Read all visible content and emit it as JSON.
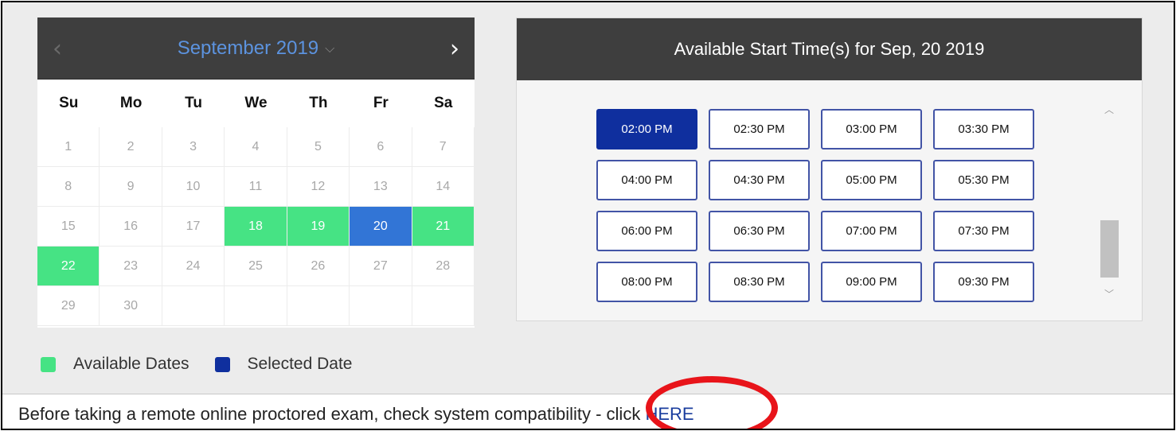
{
  "calendar": {
    "month_label": "September 2019",
    "prev_icon": "‹",
    "next_icon": "›",
    "caret_icon": "⌵",
    "weekdays": [
      "Su",
      "Mo",
      "Tu",
      "We",
      "Th",
      "Fr",
      "Sa"
    ],
    "days": [
      {
        "label": "1",
        "state": "disabled"
      },
      {
        "label": "2",
        "state": "disabled"
      },
      {
        "label": "3",
        "state": "disabled"
      },
      {
        "label": "4",
        "state": "disabled"
      },
      {
        "label": "5",
        "state": "disabled"
      },
      {
        "label": "6",
        "state": "disabled"
      },
      {
        "label": "7",
        "state": "disabled"
      },
      {
        "label": "8",
        "state": "disabled"
      },
      {
        "label": "9",
        "state": "disabled"
      },
      {
        "label": "10",
        "state": "disabled"
      },
      {
        "label": "11",
        "state": "disabled"
      },
      {
        "label": "12",
        "state": "disabled"
      },
      {
        "label": "13",
        "state": "disabled"
      },
      {
        "label": "14",
        "state": "disabled"
      },
      {
        "label": "15",
        "state": "disabled"
      },
      {
        "label": "16",
        "state": "disabled"
      },
      {
        "label": "17",
        "state": "disabled"
      },
      {
        "label": "18",
        "state": "available"
      },
      {
        "label": "19",
        "state": "available"
      },
      {
        "label": "20",
        "state": "selected"
      },
      {
        "label": "21",
        "state": "available"
      },
      {
        "label": "22",
        "state": "available"
      },
      {
        "label": "23",
        "state": "disabled"
      },
      {
        "label": "24",
        "state": "disabled"
      },
      {
        "label": "25",
        "state": "disabled"
      },
      {
        "label": "26",
        "state": "disabled"
      },
      {
        "label": "27",
        "state": "disabled"
      },
      {
        "label": "28",
        "state": "disabled"
      },
      {
        "label": "29",
        "state": "disabled"
      },
      {
        "label": "30",
        "state": "disabled"
      },
      {
        "label": "",
        "state": "blank"
      },
      {
        "label": "",
        "state": "blank"
      },
      {
        "label": "",
        "state": "blank"
      },
      {
        "label": "",
        "state": "blank"
      },
      {
        "label": "",
        "state": "blank"
      }
    ]
  },
  "legend": {
    "available_label": "Available Dates",
    "selected_label": "Selected Date",
    "available_color": "#46e384",
    "selected_color": "#0f2f9e"
  },
  "times": {
    "title": "Available Start Time(s) for Sep, 20 2019",
    "slots": [
      {
        "label": "02:00 PM",
        "selected": true
      },
      {
        "label": "02:30 PM",
        "selected": false
      },
      {
        "label": "03:00 PM",
        "selected": false
      },
      {
        "label": "03:30 PM",
        "selected": false
      },
      {
        "label": "04:00 PM",
        "selected": false
      },
      {
        "label": "04:30 PM",
        "selected": false
      },
      {
        "label": "05:00 PM",
        "selected": false
      },
      {
        "label": "05:30 PM",
        "selected": false
      },
      {
        "label": "06:00 PM",
        "selected": false
      },
      {
        "label": "06:30 PM",
        "selected": false
      },
      {
        "label": "07:00 PM",
        "selected": false
      },
      {
        "label": "07:30 PM",
        "selected": false
      },
      {
        "label": "08:00 PM",
        "selected": false
      },
      {
        "label": "08:30 PM",
        "selected": false
      },
      {
        "label": "09:00 PM",
        "selected": false
      },
      {
        "label": "09:30 PM",
        "selected": false
      }
    ],
    "scroll_up_icon": "︿",
    "scroll_down_icon": "﹀"
  },
  "footer": {
    "text": "Before taking a remote online proctored exam, check system compatibility - click ",
    "link_text": "HERE"
  },
  "colors": {
    "header_bg": "#3e3e3e",
    "accent_blue": "#5c93df",
    "selected_day": "#3275d6",
    "available_day": "#46e384",
    "selected_slot": "#0f2f9e",
    "annotation_red": "#e8141a"
  }
}
